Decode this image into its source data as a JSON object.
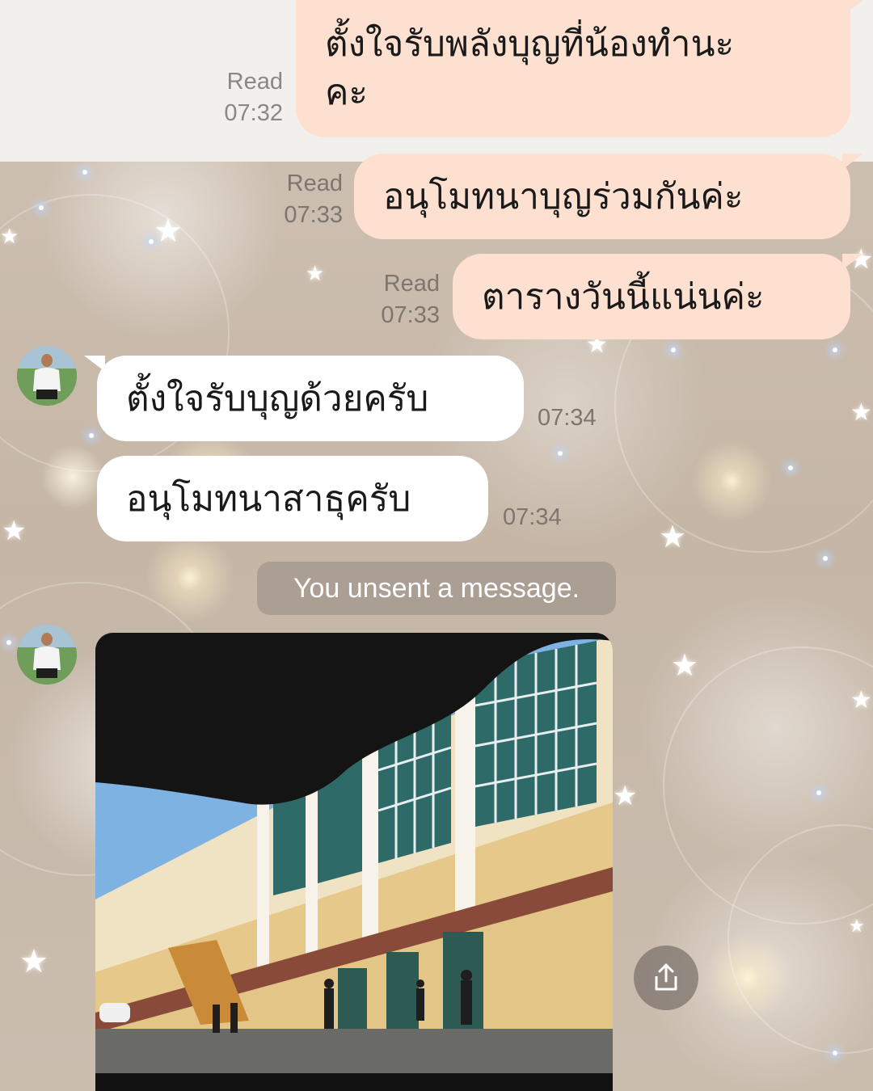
{
  "messages": [
    {
      "text_line1": "ตั้งใจรับพลังบุญที่น้องทำนะ",
      "text_line2": "คะ",
      "status": "Read",
      "time": "07:32"
    },
    {
      "text": "อนุโมทนาบุญร่วมกันค่ะ",
      "status": "Read",
      "time": "07:33"
    },
    {
      "text": "ตารางวันนี้แน่นค่ะ",
      "status": "Read",
      "time": "07:33"
    },
    {
      "text": "ตั้งใจรับบุญด้วยครับ",
      "time": "07:34"
    },
    {
      "text": "อนุโมทนาสาธุครับ",
      "time": "07:34"
    }
  ],
  "system_notice": "You unsent a message.",
  "icons": {
    "share": "share-icon",
    "avatar": "avatar"
  },
  "colors": {
    "outgoing_bubble": "#fde0d0",
    "incoming_bubble": "#ffffff",
    "meta_text": "#8b8784"
  }
}
